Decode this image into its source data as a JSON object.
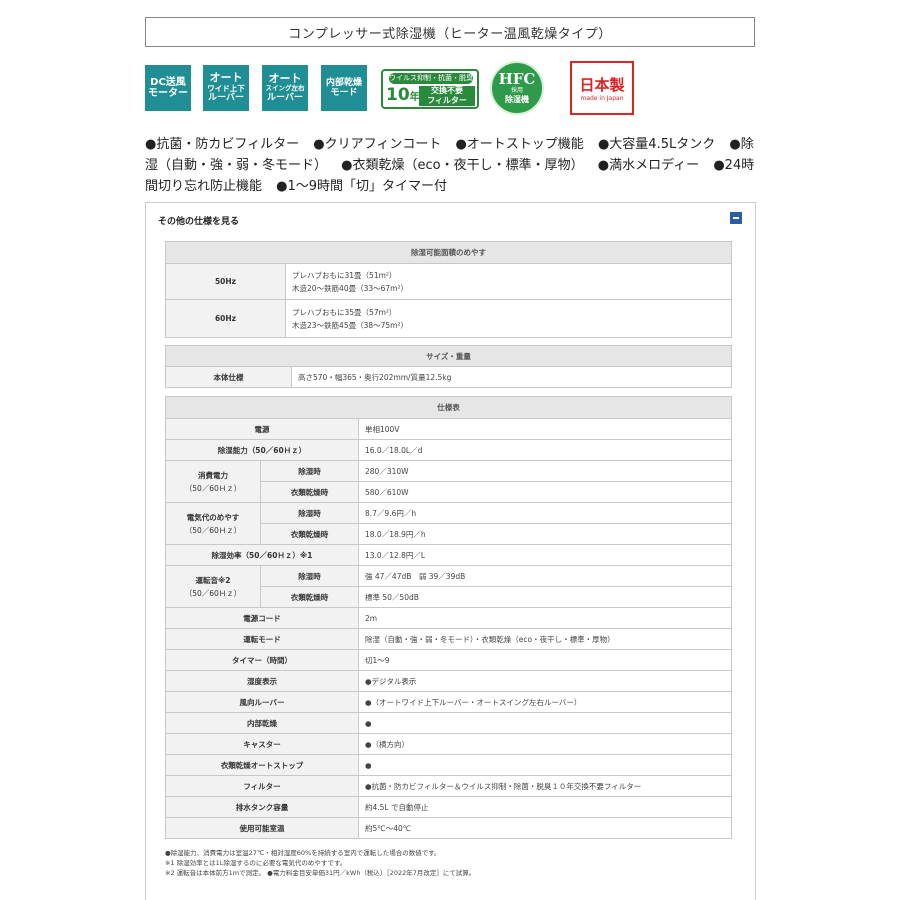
{
  "title": "コンプレッサー式除湿機（ヒーター温風乾燥タイプ）",
  "badges": {
    "dc": [
      "DC送風",
      "モーター"
    ],
    "auto_wide": [
      "オート",
      "ワイド上下",
      "ルーバー"
    ],
    "auto_swing": [
      "オート",
      "スイング左右",
      "ルーバー"
    ],
    "internal_dry": [
      "内部乾燥",
      "モード"
    ],
    "filter_top": "ウイルス抑制・抗菌・脱臭",
    "filter_num": "10",
    "filter_nen": "年",
    "filter_right": [
      "交換不要",
      "フィルター"
    ],
    "hfc_main": "HFC",
    "hfc_small": "採用",
    "hfc_big": "除湿機",
    "jp_main": "日本製",
    "jp_sub": "made in Japan"
  },
  "features": [
    "●抗菌・防カビフィルター",
    "●クリアフィンコート",
    "●オートストップ機能",
    "●大容量4.5Lタンク",
    "●除湿（自動・強・弱・冬モード）",
    "●衣類乾燥（eco・夜干し・標準・厚物）",
    "●満水メロディー",
    "●24時間切り忘れ防止機能",
    "●1～9時間「切」タイマー付"
  ],
  "panel": {
    "header": "その他の仕様を見る"
  },
  "area_table": {
    "header": "除湿可能面積のめやす",
    "rows": [
      {
        "label": "50Hz",
        "line1": "プレハブおもに31畳（51m²）",
        "line2": "木造20～鉄筋40畳（33～67m²）"
      },
      {
        "label": "60Hz",
        "line1": "プレハブおもに35畳（57m²）",
        "line2": "木造23～鉄筋45畳（38～75m²）"
      }
    ]
  },
  "size_table": {
    "header": "サイズ・重量",
    "label": "本体仕様",
    "value": "高さ570・幅365・奥行202mm/質量12.5kg"
  },
  "spec_table": {
    "header": "仕様表",
    "power_label": "電源",
    "power_value": "単相100V",
    "capacity_label": "除湿能力（50／60Ｈｚ）",
    "capacity_value": "16.0／18.0L／d",
    "consumption_label1": "消費電力",
    "consumption_label2": "（50／60Ｈｚ）",
    "dehum_label": "除湿時",
    "dry_label": "衣類乾燥時",
    "consumption_dehum": "280／310W",
    "consumption_dry": "580／610W",
    "cost_label1": "電気代のめやす",
    "cost_label2": "（50／60Ｈｚ）",
    "cost_dehum": "8.7／9.6円／h",
    "cost_dry": "18.0／18.9円／h",
    "efficiency_label": "除湿効率（50／60Ｈｚ）※1",
    "efficiency_value": "13.0／12.8円／L",
    "noise_label1": "運転音※2",
    "noise_label2": "（50／60Ｈｚ）",
    "noise_dehum": "強 47／47dB　弱 39／39dB",
    "noise_dry": "標準 50／50dB",
    "cord_label": "電源コード",
    "cord_value": "2m",
    "mode_label": "運転モード",
    "mode_value": "除湿（自動・強・弱・冬モード）・衣類乾燥（eco・夜干し・標準・厚物）",
    "timer_label": "タイマー（時間）",
    "timer_value": "切1～9",
    "humidity_label": "湿度表示",
    "humidity_value": "●デジタル表示",
    "louver_label": "風向ルーバー",
    "louver_value": "●（オートワイド上下ルーバー・オートスイング左右ルーバー）",
    "internal_label": "内部乾燥",
    "internal_value": "●",
    "caster_label": "キャスター",
    "caster_value": "●（横方向）",
    "autostop_label": "衣類乾燥オートストップ",
    "autostop_value": "●",
    "filter_label": "フィルター",
    "filter_value": "●抗菌・防カビフィルター＆ウイルス抑制・除菌・脱臭１０年交換不要フィルター",
    "tank_label": "排水タンク容量",
    "tank_value": "約4.5L で自動停止",
    "temp_label": "使用可能室温",
    "temp_value": "約5℃～40℃"
  },
  "notes": [
    "●除湿能力、消費電力は室温27℃・相対湿度60%を持続する室内で運転した場合の数値です。",
    "※1 除湿効率とは1L除湿するのに必要な電気代のめやすです。",
    "※2 運転音は本体前方1mで測定。 ●電力料金目安単価31円／kWh（税込）［2022年7月改定］にて試算。"
  ]
}
